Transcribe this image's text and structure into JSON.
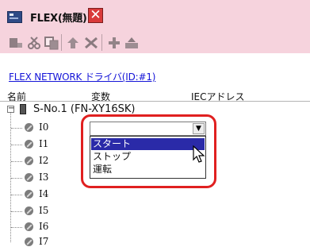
{
  "window": {
    "title": "FLEX(無題)",
    "close_glyph": "✕"
  },
  "toolbar": {
    "buttons": [
      "device-icon",
      "cut-icon",
      "copy-icon",
      "paste-icon",
      "delete-icon",
      "add-icon",
      "move-icon"
    ]
  },
  "link": {
    "text": "FLEX NETWORK ドライバ(ID:#1)"
  },
  "columns": {
    "name": "名前",
    "variable": "変数",
    "iec_address": "IECアドレス"
  },
  "tree": {
    "expander": "−",
    "device_label": "S-No.1 (FN-XY16SK)",
    "children": [
      "I0",
      "I1",
      "I2",
      "I3",
      "I4",
      "I5",
      "I6",
      "I7"
    ]
  },
  "dropdown": {
    "current_value": "",
    "arrow": "▼",
    "options": [
      "スタート",
      "ストップ",
      "運転"
    ],
    "selected_option": "スタート"
  },
  "colors": {
    "title_bar": "#f6d3dd",
    "link": "#1515d8",
    "selection": "#2a2aa8",
    "highlight": "#e02020",
    "close_button": "#d93a3a"
  }
}
